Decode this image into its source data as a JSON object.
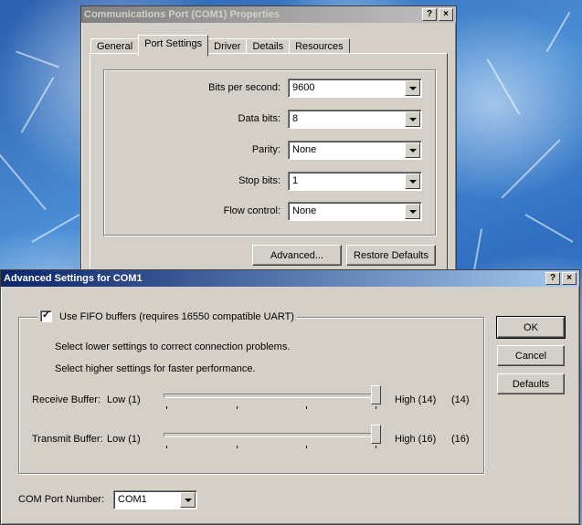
{
  "props_window": {
    "title": "Communications Port (COM1) Properties",
    "help_btn": "?",
    "close_btn": "×",
    "tabs": [
      "General",
      "Port Settings",
      "Driver",
      "Details",
      "Resources"
    ],
    "fields": [
      {
        "label": "Bits per second:",
        "value": "9600"
      },
      {
        "label": "Data bits:",
        "value": "8"
      },
      {
        "label": "Parity:",
        "value": "None"
      },
      {
        "label": "Stop bits:",
        "value": "1"
      },
      {
        "label": "Flow control:",
        "value": "None"
      }
    ],
    "advanced_label": "Advanced...",
    "restore_label": "Restore Defaults"
  },
  "adv_window": {
    "title": "Advanced Settings for COM1",
    "help_btn": "?",
    "close_btn": "×",
    "fifo_label": "Use FIFO buffers (requires 16550 compatible UART)",
    "fifo_checked": true,
    "hint1": "Select lower settings to correct connection problems.",
    "hint2": "Select higher settings for faster performance.",
    "receive": {
      "label": "Receive Buffer:",
      "low": "Low (1)",
      "high": "High (14)",
      "value": "(14)",
      "level": 1.0
    },
    "transmit": {
      "label": "Transmit Buffer:",
      "low": "Low (1)",
      "high": "High (16)",
      "value": "(16)",
      "level": 1.0
    },
    "ok_label": "OK",
    "cancel_label": "Cancel",
    "defaults_label": "Defaults",
    "com_label": "COM Port Number:",
    "com_value": "COM1"
  }
}
